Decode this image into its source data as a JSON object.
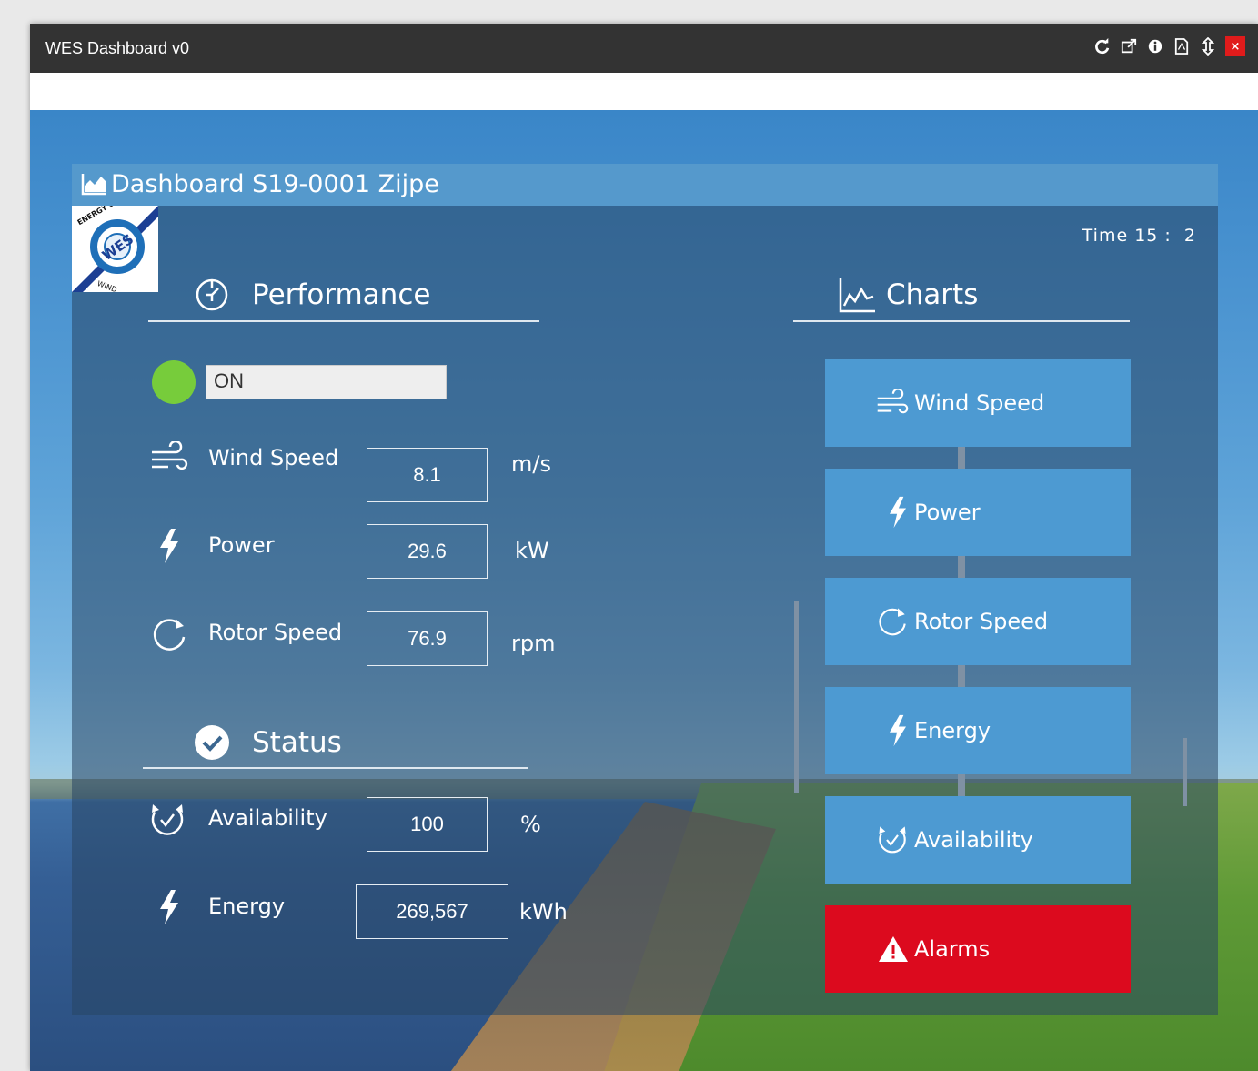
{
  "window": {
    "title": "WES Dashboard v0",
    "toolbar_icons": [
      "refresh-icon",
      "external-link-icon",
      "info-icon",
      "pdf-icon",
      "resize-icon",
      "close-icon"
    ],
    "close_label": "×"
  },
  "panel": {
    "title": "Dashboard S19-0001 Zijpe",
    "time_label": "Time",
    "time_value": "15 :  2",
    "logo_texts": [
      "ENERGY SOLUTIONS",
      "WES",
      "WIND"
    ]
  },
  "performance": {
    "title": "Performance",
    "state": "ON",
    "state_color": "#77cc3b",
    "rows": [
      {
        "label": "Wind Speed",
        "value": "8.1",
        "unit": "m/s",
        "icon": "wind-icon"
      },
      {
        "label": "Power",
        "value": "29.6",
        "unit": "kW",
        "icon": "bolt-icon"
      },
      {
        "label": "Rotor Speed",
        "value": "76.9",
        "unit": "rpm",
        "icon": "rotate-icon"
      }
    ]
  },
  "status": {
    "title": "Status",
    "rows": [
      {
        "label": "Availability",
        "value": "100",
        "unit": "%",
        "icon": "availability-icon"
      },
      {
        "label": "Energy",
        "value": "269,567",
        "unit": "kWh",
        "icon": "bolt-icon"
      }
    ]
  },
  "charts": {
    "title": "Charts",
    "buttons": [
      {
        "label": "Wind Speed",
        "icon": "wind-icon",
        "color": "#4d9ad2"
      },
      {
        "label": "Power",
        "icon": "bolt-icon",
        "color": "#4d9ad2"
      },
      {
        "label": "Rotor Speed",
        "icon": "rotate-icon",
        "color": "#4d9ad2"
      },
      {
        "label": "Energy",
        "icon": "bolt-icon",
        "color": "#4d9ad2"
      },
      {
        "label": "Availability",
        "icon": "availability-icon",
        "color": "#4d9ad2"
      },
      {
        "label": "Alarms",
        "icon": "warning-icon",
        "color": "#dc0a1e"
      }
    ]
  }
}
